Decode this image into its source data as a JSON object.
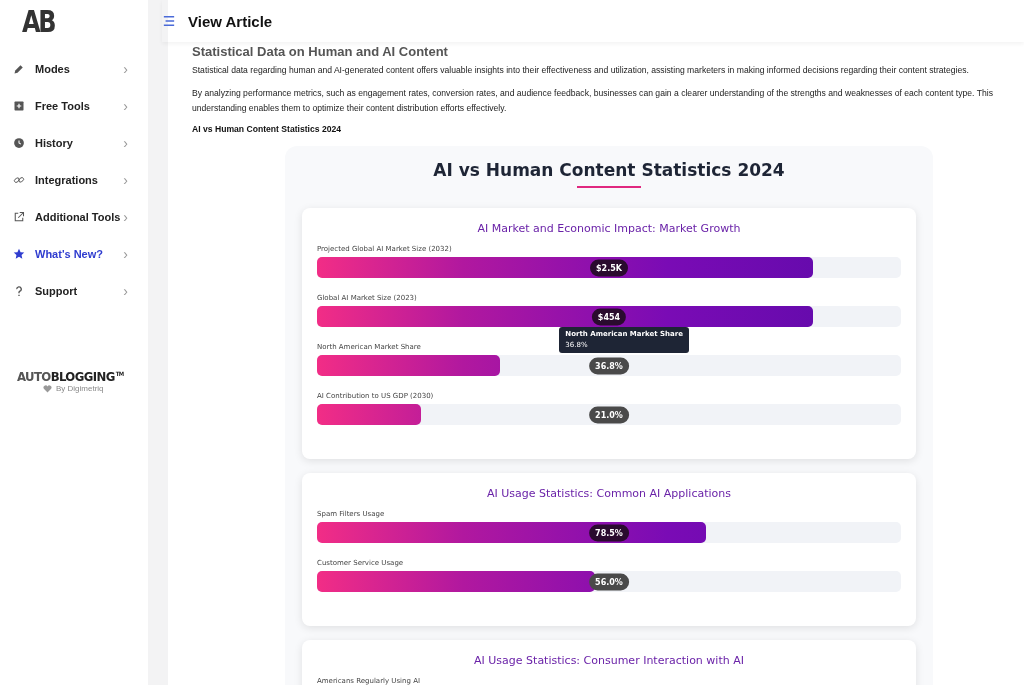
{
  "logo": {
    "text": "AB"
  },
  "header": {
    "title": "View Article"
  },
  "sidebar": {
    "items": [
      {
        "label": "Modes",
        "selected": false
      },
      {
        "label": "Free Tools",
        "selected": false
      },
      {
        "label": "History",
        "selected": false
      },
      {
        "label": "Integrations",
        "selected": false
      },
      {
        "label": "Additional Tools",
        "selected": false
      },
      {
        "label": "What's New?",
        "selected": true
      },
      {
        "label": "Support",
        "selected": false
      }
    ],
    "chevron": "›",
    "brand": {
      "light": "AUTO",
      "bold": "BLOGGING",
      "tm": "TM",
      "byline": "By Digimetriq"
    }
  },
  "article": {
    "heading": "Statistical Data on Human and AI Content",
    "paragraphs": [
      "Statistical data regarding human and AI-generated content offers valuable insights into their effectiveness and utilization, assisting marketers in making informed decisions regarding their content strategies.",
      "By analyzing performance metrics, such as engagement rates, conversion rates, and audience feedback, businesses can gain a clearer understanding of the strengths and weaknesses of each content type. This understanding enables them to optimize their content distribution efforts effectively."
    ],
    "subheading": "AI vs Human Content Statistics 2024"
  },
  "infographic": {
    "title": "AI vs Human Content Statistics 2024",
    "sections": [
      {
        "title": "AI Market and Economic Impact: Market Growth",
        "rows": [
          {
            "label": "Projected Global AI Market Size (2032)",
            "value": "$2.5K",
            "level": 0.85
          },
          {
            "label": "Global AI Market Size (2023)",
            "value": "$454",
            "level": 0.85
          },
          {
            "label": "North American Market Share",
            "value": "36.8%",
            "level": 0.313,
            "tooltip": {
              "title": "North American Market Share",
              "value": "36.8%"
            }
          },
          {
            "label": "AI Contribution to US GDP (2030)",
            "value": "21.0%",
            "level": 0.178
          }
        ]
      },
      {
        "title": "AI Usage Statistics: Common AI Applications",
        "rows": [
          {
            "label": "Spam Filters Usage",
            "value": "78.5%",
            "level": 0.666
          },
          {
            "label": "Customer Service Usage",
            "value": "56.0%",
            "level": 0.476
          }
        ]
      },
      {
        "title": "AI Usage Statistics: Consumer Interaction with AI",
        "rows": [
          {
            "label": "Americans Regularly Using AI"
          }
        ]
      }
    ]
  }
}
